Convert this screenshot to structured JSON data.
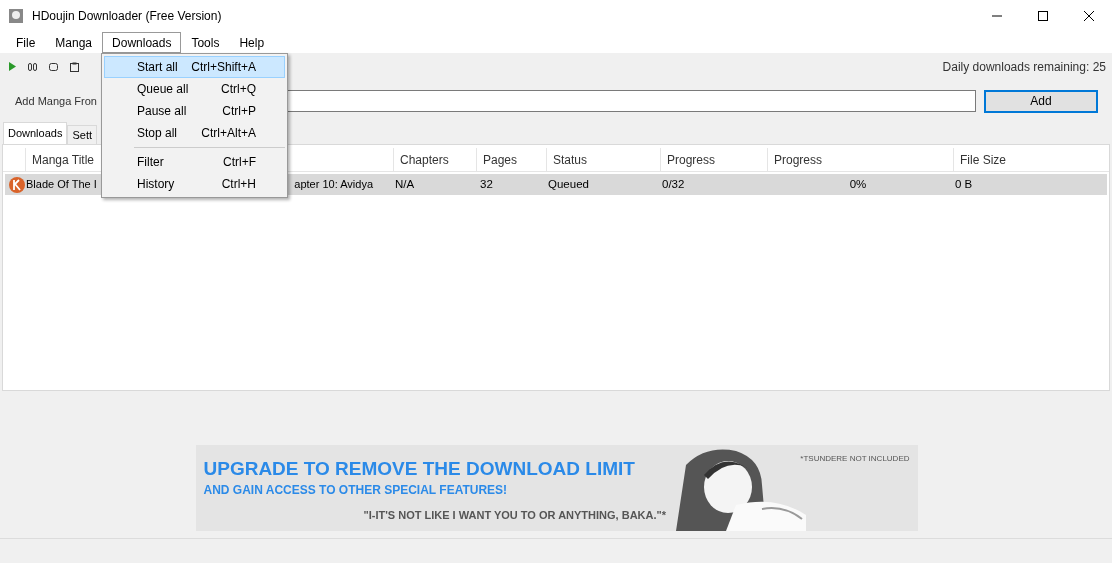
{
  "window": {
    "title": "HDoujin Downloader (Free Version)"
  },
  "menubar": [
    {
      "label": "File",
      "selected": false
    },
    {
      "label": "Manga",
      "selected": false
    },
    {
      "label": "Downloads",
      "selected": true
    },
    {
      "label": "Tools",
      "selected": false
    },
    {
      "label": "Help",
      "selected": false
    }
  ],
  "dropdown": [
    {
      "kind": "item",
      "label": "Start all",
      "shortcut": "Ctrl+Shift+A",
      "selected": true
    },
    {
      "kind": "item",
      "label": "Queue all",
      "shortcut": "Ctrl+Q",
      "selected": false
    },
    {
      "kind": "item",
      "label": "Pause all",
      "shortcut": "Ctrl+P",
      "selected": false
    },
    {
      "kind": "item",
      "label": "Stop all",
      "shortcut": "Ctrl+Alt+A",
      "selected": false
    },
    {
      "kind": "separator"
    },
    {
      "kind": "item",
      "label": "Filter",
      "shortcut": "Ctrl+F",
      "selected": false
    },
    {
      "kind": "item",
      "label": "History",
      "shortcut": "Ctrl+H",
      "selected": false
    }
  ],
  "toolbar": {
    "daily_remaining": "Daily downloads remaining: 25"
  },
  "add_row": {
    "label": "Add Manga Fron",
    "button": "Add"
  },
  "tabs": [
    {
      "label": "Downloads",
      "selected": true
    },
    {
      "label": "Sett",
      "selected": false
    }
  ],
  "table": {
    "columns": [
      "Manga Title",
      "Chapters",
      "Pages",
      "Status",
      "Progress",
      "Progress",
      "File Size"
    ],
    "rows": [
      {
        "title_start": "Blade Of The I",
        "title_end": "apter 10: Avidya",
        "chapters": "N/A",
        "pages": "32",
        "status": "Queued",
        "progress": "0/32",
        "percent": "0%",
        "size": "0 B",
        "selected": true
      }
    ]
  },
  "banner": {
    "headline": "UPGRADE TO REMOVE THE DOWNLOAD LIMIT",
    "subline": "AND GAIN ACCESS TO OTHER SPECIAL FEATURES!",
    "quote": "\"I-IT'S NOT LIKE I WANT YOU TO OR ANYTHING, BAKA.\"*",
    "note": "*TSUNDERE NOT INCLUDED"
  }
}
